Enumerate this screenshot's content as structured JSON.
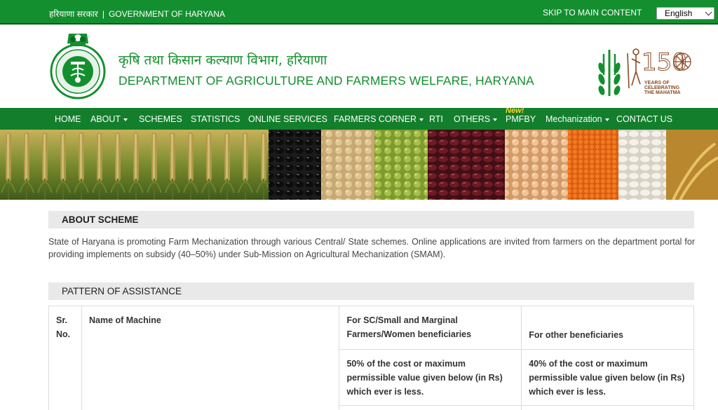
{
  "topbar": {
    "hindi_govt": "हरियाणा सरकार",
    "separator": "|",
    "govt_name": "GOVERNMENT OF HARYANA",
    "skip_link": "SKIP TO MAIN CONTENT",
    "language_selected": "English"
  },
  "header": {
    "hindi_title": "कृषि तथा किसान कल्याण विभाग, हरियाणा",
    "english_title": "DEPARTMENT OF AGRICULTURE AND FARMERS WELFARE, HARYANA",
    "gandhi_logo_number": "150",
    "gandhi_logo_text": [
      "YEARS OF",
      "CELEBRATING",
      "THE MAHATMA"
    ]
  },
  "nav": {
    "items": [
      {
        "label": "HOME",
        "dropdown": false
      },
      {
        "label": "ABOUT",
        "dropdown": true
      },
      {
        "label": "SCHEMES",
        "dropdown": false
      },
      {
        "label": "STATISTICS",
        "dropdown": false
      },
      {
        "label": "ONLINE SERVICES",
        "dropdown": false
      },
      {
        "label": "FARMERS CORNER",
        "dropdown": true
      },
      {
        "label": "RTI",
        "dropdown": false
      },
      {
        "label": "OTHERS",
        "dropdown": true
      },
      {
        "label": "PMFBY",
        "dropdown": false
      },
      {
        "label": "Mechanization",
        "dropdown": true
      },
      {
        "label": "CONTACT US",
        "dropdown": false
      }
    ],
    "new_badge": "New!"
  },
  "about": {
    "heading": "ABOUT SCHEME",
    "text": "State of Haryana is promoting Farm Mechanization through various Central/ State schemes. Online applications are invited from farmers on the department portal for providing implements on subsidy (40–50%) under Sub-Mission on Agricultural Mechanization (SMAM)."
  },
  "pattern": {
    "heading": "PATTERN OF ASSISTANCE",
    "table": {
      "col_srno": "Sr. No.",
      "col_name": "Name of Machine",
      "col_sc": "For SC/Small and Marginal Farmers/Women beneficiaries",
      "col_other": "For other beneficiaries",
      "sub_sc": "50% of the cost or maximum permissible value given below (in Rs) which ever is less.",
      "sub_other": "40% of the cost or maximum permissible value given below (in Rs) which ever is less."
    }
  },
  "colors": {
    "topbar": "#148f2f",
    "nav": "#137f2c",
    "title_green": "#148f2f",
    "section_bg": "#e9e9e9"
  }
}
